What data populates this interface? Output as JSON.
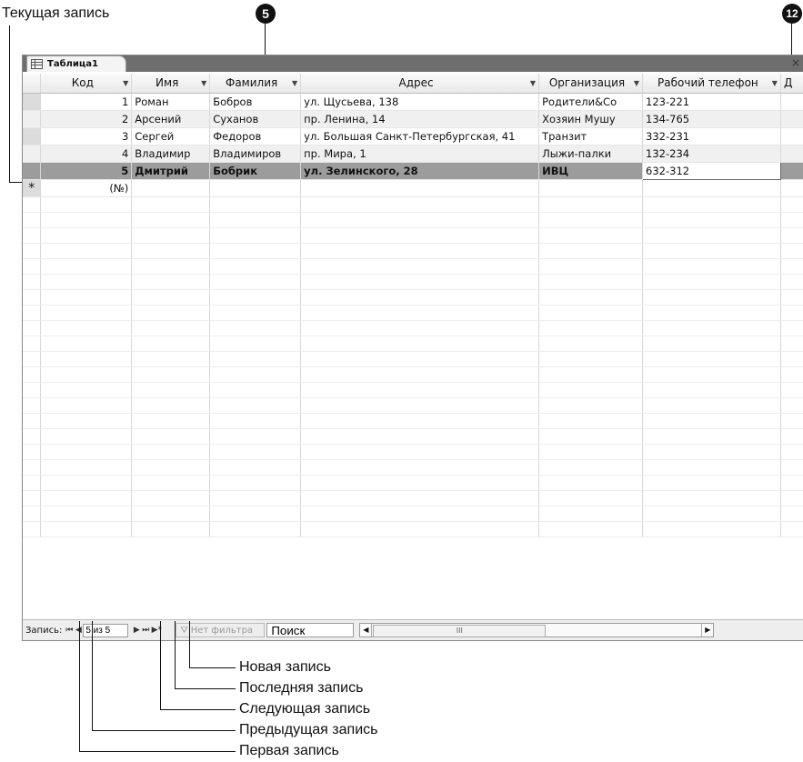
{
  "callouts": {
    "current_record": "Текущая запись",
    "badge_left": "5",
    "badge_right": "12",
    "new_record": "Новая запись",
    "last_record": "Последняя запись",
    "next_record": "Следующая запись",
    "prev_record": "Предыдущая запись",
    "first_record": "Первая запись"
  },
  "tab": {
    "title": "Таблица1",
    "icon": "table-icon",
    "close": "×"
  },
  "columns": [
    "Код",
    "Имя",
    "Фамилия",
    "Адрес",
    "Организация",
    "Рабочий телефон",
    "Д"
  ],
  "rows": [
    [
      "1",
      "Роман",
      "Бобров",
      "ул. Щусьева, 138",
      "Родители&Co",
      "123-221"
    ],
    [
      "2",
      "Арсений",
      "Суханов",
      "пр. Ленина, 14",
      "Хозяин Мушу",
      "134-765"
    ],
    [
      "3",
      "Сергей",
      "Федоров",
      "ул. Большая Санкт-Петербургская, 41",
      "Транзит",
      "332-231"
    ],
    [
      "4",
      "Владимир",
      "Владимиров",
      "пр. Мира, 1",
      "Лыжи-палки",
      "132-234"
    ],
    [
      "5",
      "Дмитрий",
      "Бобрик",
      "ул. Зелинского,  28",
      "ИВЦ",
      "632-312"
    ]
  ],
  "new_row": {
    "marker": "*",
    "id_placeholder": "(№)"
  },
  "navbar": {
    "label": "Запись:",
    "first": "⏮",
    "prev": "◀",
    "record_value": "5 из 5",
    "next": "▶",
    "last": "⏭",
    "new": "▶*",
    "filter": "Нет фильтра",
    "search": "Поиск",
    "scroll_mid": "III"
  }
}
